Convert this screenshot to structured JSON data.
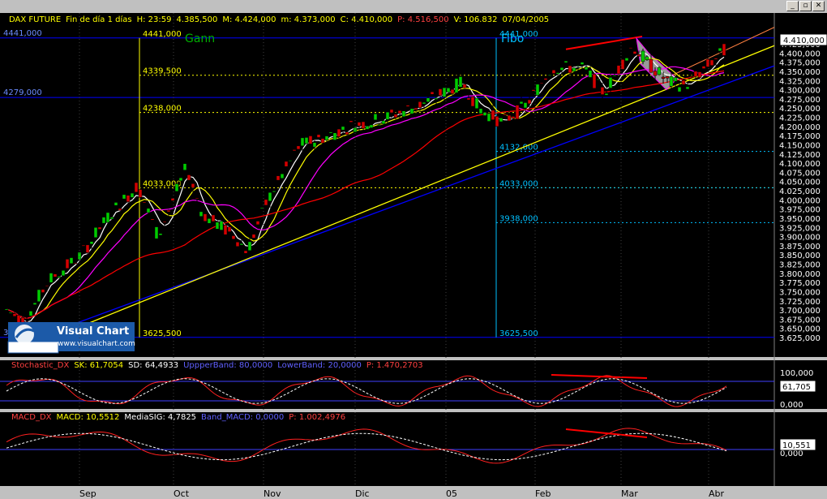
{
  "window": {
    "header": {
      "symbol": "DAX FUTURE",
      "period": "Fin de día 1 días",
      "time": "H: 23:59",
      "open": "4.385,500",
      "high": "M: 4.424,000",
      "low": "m: 4.373,000",
      "close": "C: 4.410,000",
      "price": "P: 4.516,500",
      "volume": "V: 106.832",
      "date": "07/04/2005"
    },
    "buttons": [
      "_",
      "▫",
      "✕"
    ]
  },
  "colors": {
    "bg": "#000000",
    "grid": "#808080",
    "up": "#00cc00",
    "down": "#d40000",
    "fast_ma": "#ffffff",
    "mid_ma": "#ffff00",
    "slow_ma": "#ff00ff",
    "long_ma": "#ff0000",
    "trendline": "#0000ff",
    "text": "#ffff00",
    "axis_text": "#ffffff"
  },
  "main": {
    "levels": [
      {
        "label": "4441,000",
        "value": 4441,
        "color": "#0000ff"
      },
      {
        "label": "4279,000",
        "value": 4279,
        "color": "#0000ff"
      },
      {
        "label": "3625,500",
        "value": 3625.5,
        "color": "#0000ff"
      }
    ],
    "gann": {
      "title": "Gann",
      "labels": [
        {
          "text": "4441,000",
          "value": 4441
        },
        {
          "text": "4339,500",
          "value": 4339.5
        },
        {
          "text": "4238,000",
          "value": 4238
        },
        {
          "text": "4033,000",
          "value": 4033
        },
        {
          "text": "3625,500",
          "value": 3625.5
        }
      ]
    },
    "fibo": {
      "title": "Fibo",
      "labels": [
        {
          "text": "4441,000",
          "value": 4441
        },
        {
          "text": "4132,000",
          "value": 4132
        },
        {
          "text": "4033,000",
          "value": 4033
        },
        {
          "text": "3938,000",
          "value": 3938
        },
        {
          "text": "3625,500",
          "value": 3625.5
        }
      ]
    },
    "y_ticks": [
      "4.425,000",
      "4.400,000",
      "4.375,000",
      "4.350,000",
      "4.325,000",
      "4.300,000",
      "4.275,000",
      "4.250,000",
      "4.225,000",
      "4.200,000",
      "4.175,000",
      "4.150,000",
      "4.125,000",
      "4.100,000",
      "4.075,000",
      "4.050,000",
      "4.025,000",
      "4.000,000",
      "3.975,000",
      "3.950,000",
      "3.925,000",
      "3.900,000",
      "3.875,000",
      "3.850,000",
      "3.825,000",
      "3.800,000",
      "3.775,000",
      "3.750,000",
      "3.725,000",
      "3.700,000",
      "3.675,000",
      "3.650,000",
      "3.625,000"
    ],
    "last_price": "4.410,000",
    "logo": {
      "title": "Visual Chart",
      "url": "www.visualchart.com"
    }
  },
  "stochastic": {
    "label": "Stochastic_DX",
    "sk": "SK: 61,7054",
    "sd": "SD: 64,4933",
    "upper": "UppperBand: 80,0000",
    "lower": "LowerBand: 20,0000",
    "p": "P: 1.470,2703",
    "ticks": [
      "100,000",
      "0,000"
    ],
    "value": "61,705"
  },
  "macd": {
    "label": "MACD_DX",
    "macd": "MACD: 10,5512",
    "sig": "MediaSIG: 4,7825",
    "band": "Band_MACD: 0,0000",
    "p": "P: 1.002,4976",
    "ticks": [
      "0,000"
    ],
    "value": "10,551"
  },
  "x_axis": [
    {
      "label": "Sep",
      "x": 98
    },
    {
      "label": "Oct",
      "x": 214
    },
    {
      "label": "Nov",
      "x": 325
    },
    {
      "label": "Dic",
      "x": 438
    },
    {
      "label": "05",
      "x": 550
    },
    {
      "label": "Feb",
      "x": 660
    },
    {
      "label": "Mar",
      "x": 766
    },
    {
      "label": "Abr",
      "x": 874
    }
  ],
  "chart_data": {
    "type": "candlestick",
    "title": "DAX FUTURE",
    "y_range": [
      3600,
      4460
    ],
    "x_categories": [
      "Sep",
      "Oct",
      "Nov",
      "Dic",
      "05",
      "Feb",
      "Mar",
      "Abr"
    ],
    "key_points": [
      {
        "t": "late Aug",
        "close": 3700
      },
      {
        "t": "early Oct",
        "close": 4090
      },
      {
        "t": "late Oct",
        "close": 3870
      },
      {
        "t": "Dec",
        "close": 4200
      },
      {
        "t": "end Dec",
        "close": 4330
      },
      {
        "t": "mid Jan",
        "close": 4200
      },
      {
        "t": "early Feb",
        "close": 4380
      },
      {
        "t": "early Mar",
        "close": 4420
      },
      {
        "t": "mid Mar",
        "close": 4290
      },
      {
        "t": "07/04/2005",
        "close": 4410
      }
    ],
    "stochastic": {
      "upper_band": 80,
      "lower_band": 20,
      "sk": 61.7054,
      "sd": 64.4933
    },
    "macd": {
      "macd": 10.5512,
      "signal": 4.7825,
      "band": 0
    }
  }
}
